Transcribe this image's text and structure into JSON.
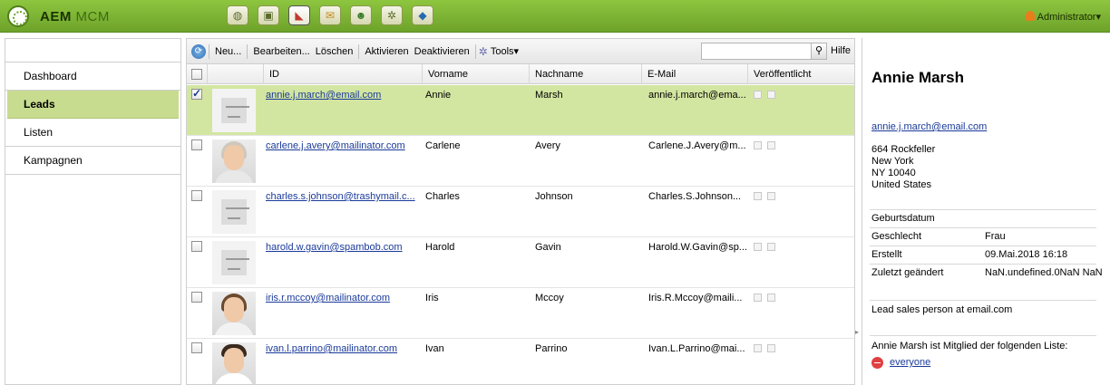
{
  "header": {
    "brand": "AEM",
    "product": "MCM",
    "user": "Administrator",
    "icons": [
      "globe-icon",
      "camera-icon",
      "megaphone-icon",
      "mail-icon",
      "users-icon",
      "gear-icon",
      "tag-icon"
    ]
  },
  "nav": {
    "items": [
      "Dashboard",
      "Leads",
      "Listen",
      "Kampagnen"
    ],
    "selected": "Leads"
  },
  "toolbar": {
    "new": "Neu...",
    "edit": "Bearbeiten...",
    "delete": "Löschen",
    "activate": "Aktivieren",
    "deactivate": "Deaktivieren",
    "tools": "Tools",
    "search_placeholder": "",
    "help": "Hilfe"
  },
  "grid": {
    "columns": [
      "ID",
      "Vorname",
      "Nachname",
      "E-Mail",
      "Veröffentlicht"
    ],
    "rows": [
      {
        "id": "annie.j.march@email.com",
        "first": "Annie",
        "last": "Marsh",
        "email": "annie.j.march@ema...",
        "checked": true,
        "photo": "placeholder"
      },
      {
        "id": "carlene.j.avery@mailinator.com",
        "first": "Carlene",
        "last": "Avery",
        "email": "Carlene.J.Avery@m...",
        "checked": false,
        "photo": "woman-grey"
      },
      {
        "id": "charles.s.johnson@trashymail.c...",
        "first": "Charles",
        "last": "Johnson",
        "email": "Charles.S.Johnson...",
        "checked": false,
        "photo": "placeholder"
      },
      {
        "id": "harold.w.gavin@spambob.com",
        "first": "Harold",
        "last": "Gavin",
        "email": "Harold.W.Gavin@sp...",
        "checked": false,
        "photo": "placeholder"
      },
      {
        "id": "iris.r.mccoy@mailinator.com",
        "first": "Iris",
        "last": "Mccoy",
        "email": "Iris.R.Mccoy@maili...",
        "checked": false,
        "photo": "woman-brown"
      },
      {
        "id": "ivan.l.parrino@mailinator.com",
        "first": "Ivan",
        "last": "Parrino",
        "email": "Ivan.L.Parrino@mai...",
        "checked": false,
        "photo": "man"
      }
    ]
  },
  "detail": {
    "name": "Annie Marsh",
    "email": "annie.j.march@email.com",
    "address": [
      "664 Rockfeller",
      "New York",
      "NY 10040",
      "United States"
    ],
    "birthday_label": "Geburtsdatum",
    "gender_label": "Geschlecht",
    "gender_value": "Frau",
    "created_label": "Erstellt",
    "created_value": "09.Mai.2018 16:18",
    "modified_label": "Zuletzt geändert",
    "modified_value": "NaN.undefined.0NaN NaN",
    "sales": "Lead sales person at email.com",
    "member_text": "Annie Marsh ist Mitglied der folgenden Liste:",
    "list": "everyone"
  },
  "colors": {
    "topbar": "#7cb533",
    "selection": "#d3e6a1",
    "link": "#1a3a9a"
  }
}
